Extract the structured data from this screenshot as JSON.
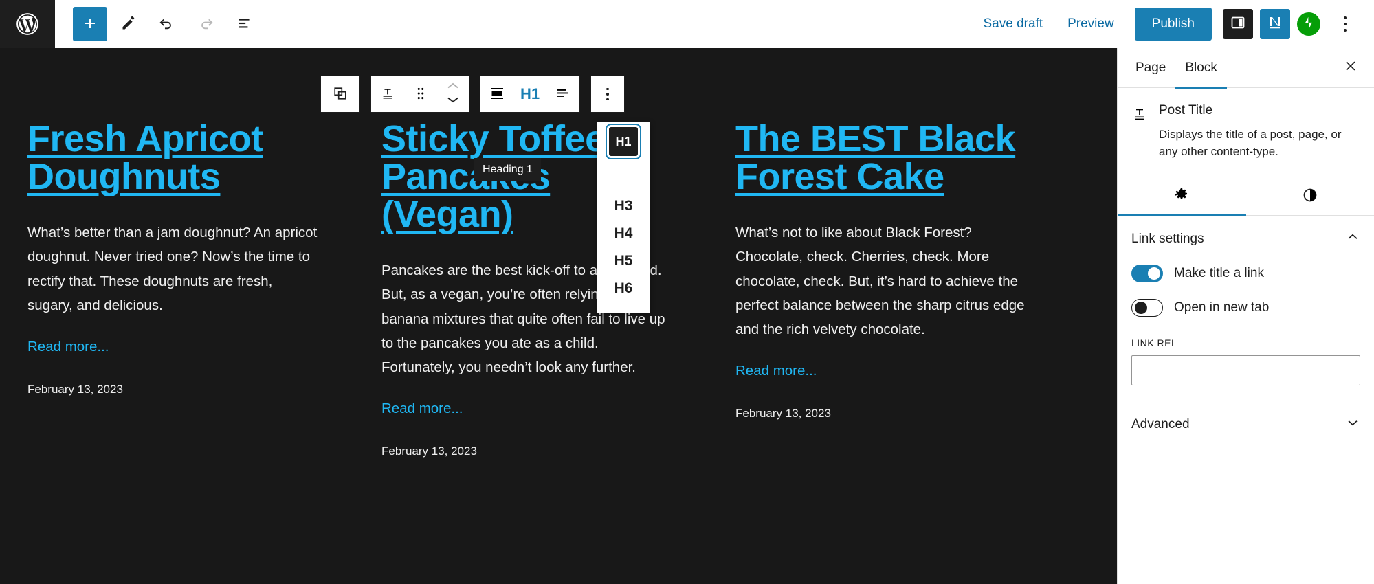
{
  "topbar": {
    "logo_icon": "wordpress-logo-icon",
    "left_tools": [
      {
        "name": "add-block-button",
        "icon": "plus-icon"
      },
      {
        "name": "edit-tool-button",
        "icon": "pencil-icon"
      },
      {
        "name": "undo-button",
        "icon": "undo-arrow-icon"
      },
      {
        "name": "redo-button",
        "icon": "redo-arrow-icon"
      },
      {
        "name": "document-overview-button",
        "icon": "list-view-icon"
      }
    ],
    "save_draft_label": "Save draft",
    "preview_label": "Preview",
    "publish_label": "Publish",
    "settings_sidebar_icon": "sidebar-panel-icon",
    "notion_icon": "letter-n-icon",
    "jetpack_icon": "jetpack-bolt-icon",
    "options_icon": "kebab-menu-icon"
  },
  "block_toolbar": {
    "parent_block_label": "select-parent-block",
    "block_type_icon": "post-title-icon",
    "drag_handle_icon": "drag-dots-icon",
    "move_up_icon": "chevron-up-icon",
    "move_down_icon": "chevron-down-icon",
    "align_icon": "align-block-icon",
    "heading_level_label": "H1",
    "text_align_icon": "text-align-left-icon",
    "more_options_icon": "kebab-menu-icon"
  },
  "heading_dropdown": {
    "tooltip": "Heading 1",
    "selected": "H1",
    "options": [
      "H3",
      "H4",
      "H5",
      "H6"
    ]
  },
  "canvas": {
    "posts": [
      {
        "title": "Fresh Apricot Doughnuts",
        "excerpt": "What’s better than a jam doughnut? An apricot doughnut. Never tried one? Now’s the time to rectify that. These doughnuts are fresh, sugary, and delicious.",
        "read_more": "Read more...",
        "date": "February 13, 2023"
      },
      {
        "title": "Sticky Toffee Pancakes (Vegan)",
        "excerpt": "Pancakes are the best kick-off to a weekend. But, as a vegan, you’re often relying on banana mixtures that quite often fail to live up to the pancakes you ate as a child. Fortunately, you needn’t look any further.",
        "read_more": "Read more...",
        "date": "February 13, 2023"
      },
      {
        "title": "The BEST Black Forest Cake",
        "excerpt": "What’s not to like about Black Forest? Chocolate, check. Cherries, check. More chocolate, check. But, it’s hard to achieve the perfect balance between the sharp citrus edge and the rich velvety chocolate.",
        "read_more": "Read more...",
        "date": "February 13, 2023"
      }
    ]
  },
  "sidebar": {
    "tab_page": "Page",
    "tab_block": "Block",
    "close_icon": "close-x-icon",
    "block_icon": "post-title-icon",
    "block_title": "Post Title",
    "block_description": "Displays the title of a post, page, or any other content-type.",
    "icon_tab_settings": "gear-icon",
    "icon_tab_styles": "contrast-half-circle-icon",
    "link_settings_title": "Link settings",
    "link_settings_chevron": "chevron-up-icon",
    "toggle_make_link_label": "Make title a link",
    "toggle_make_link_state": "on",
    "toggle_new_tab_label": "Open in new tab",
    "toggle_new_tab_state": "off",
    "link_rel_label": "LINK REL",
    "link_rel_value": "",
    "link_rel_placeholder": "",
    "advanced_title": "Advanced",
    "advanced_chevron": "chevron-down-icon"
  },
  "colors": {
    "accent_blue": "#1a7fb3",
    "link_blue": "#20b7f3",
    "canvas_bg": "#181818",
    "dark": "#1e1e1e"
  }
}
